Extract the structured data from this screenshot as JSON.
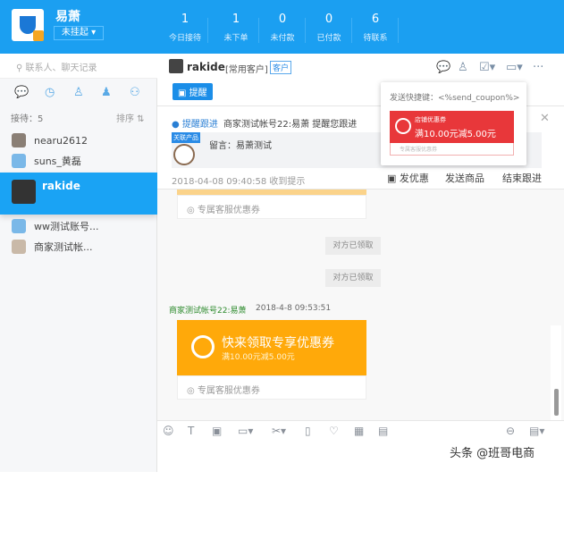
{
  "header": {
    "shop_name": "易萧",
    "status": "未挂起",
    "stats": [
      {
        "n": "1",
        "l": "今日接待"
      },
      {
        "n": "1",
        "l": "未下单"
      },
      {
        "n": "0",
        "l": "未付款"
      },
      {
        "n": "0",
        "l": "已付款"
      },
      {
        "n": "6",
        "l": "待联系"
      }
    ]
  },
  "sidebar": {
    "search_placeholder": "联系人、聊天记录",
    "count": "接待：5",
    "sort": "排序 ⇅",
    "contacts": [
      "nearu2612",
      "suns_黄磊",
      "rakide",
      "ww测试账号...",
      "商家测试帐..."
    ]
  },
  "chat": {
    "name": "rakide",
    "tag": "[常用客户]",
    "badge": "客户",
    "remind": "▣ 提醒",
    "notice": {
      "link": "提醒跟进",
      "text": "商家测试帐号22:易萧 提醒您跟进",
      "tag": "关联产品",
      "message": "留言：易萧测试",
      "time": "2018-04-08 09:40:58 收到提示",
      "actions": [
        "发优惠",
        "发送商品",
        "结束跟进"
      ]
    },
    "popup": {
      "shortcut": "发送快捷键：<%send_coupon%>",
      "coupon_type": "店铺优惠券",
      "coupon_value": "满10.00元减5.00元",
      "footer": "专属客服优惠券"
    },
    "messages": {
      "coupon_footer": "专属客服优惠券",
      "sys1": "对方已领取",
      "sys2": "对方已领取",
      "sender": "商家测试帐号22:易萧",
      "time": "2018-4-8 09:53:51",
      "coupon_title": "快来领取专享优惠券",
      "coupon_value": "满10.00元减5.00元",
      "coupon_footer2": "专属客服优惠券"
    }
  },
  "watermark": "头条 @班哥电商"
}
